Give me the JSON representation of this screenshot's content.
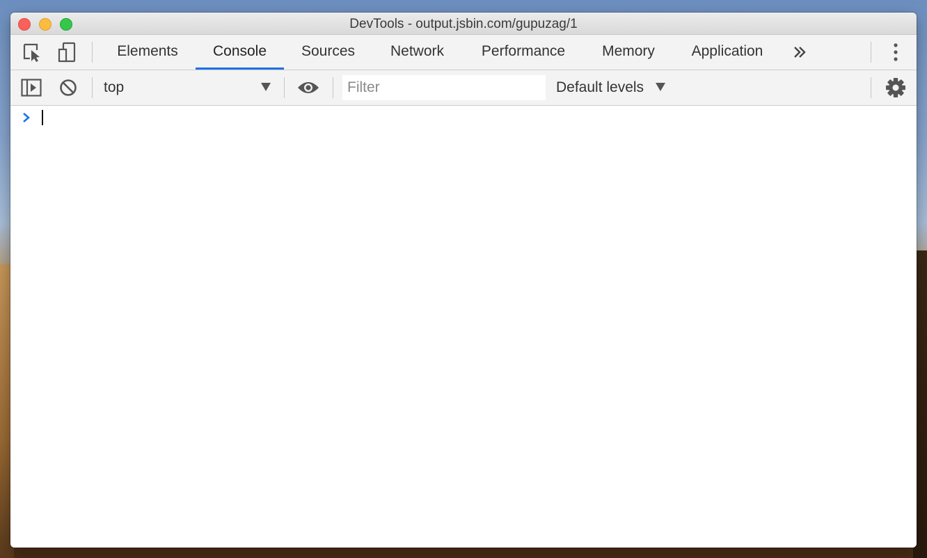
{
  "window": {
    "title": "DevTools - output.jsbin.com/gupuzag/1"
  },
  "tabs": [
    {
      "label": "Elements"
    },
    {
      "label": "Console"
    },
    {
      "label": "Sources"
    },
    {
      "label": "Network"
    },
    {
      "label": "Performance"
    },
    {
      "label": "Memory"
    },
    {
      "label": "Application"
    }
  ],
  "active_tab": "Console",
  "toolbar": {
    "context": "top",
    "filter_placeholder": "Filter",
    "filter_value": "",
    "levels": "Default levels"
  },
  "icons": {
    "inspect": "inspect-element-icon",
    "device": "device-toolbar-icon",
    "more_tabs": "more-tabs-icon",
    "kebab": "kebab-menu-icon",
    "sidebar": "console-sidebar-icon",
    "clear": "clear-console-icon",
    "eye": "live-expression-icon",
    "gear": "settings-gear-icon",
    "prompt": "console-prompt-chevron-icon"
  },
  "colors": {
    "accent": "#1a73e8",
    "prompt": "#1a73e8"
  }
}
